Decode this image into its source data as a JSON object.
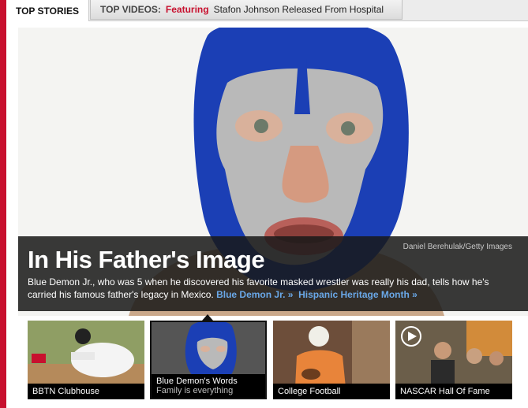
{
  "tabs": {
    "top_stories": "TOP STORIES",
    "top_videos_label": "TOP VIDEOS:",
    "featuring": "Featuring",
    "video_headline": "Stafon Johnson Released From Hospital"
  },
  "hero": {
    "credit": "Daniel Berehulak/Getty Images",
    "headline": "In His Father's Image",
    "dek": "Blue Demon Jr., who was 5 when he discovered his favorite masked wrestler was really his dad, tells how he's carried his famous father's legacy in Mexico.",
    "link1": "Blue Demon Jr. »",
    "link2": "Hispanic Heritage Month »"
  },
  "thumbnails": [
    {
      "label": "BBTN Clubhouse"
    },
    {
      "label": "Blue Demon's Words",
      "sub": "Family is everything"
    },
    {
      "label": "College Football"
    },
    {
      "label": "NASCAR Hall Of Fame"
    }
  ],
  "colors": {
    "accent": "#c8102e",
    "link": "#6aa8e8",
    "mask_blue": "#1b3fb5",
    "mask_silver": "#b9b9b9"
  }
}
